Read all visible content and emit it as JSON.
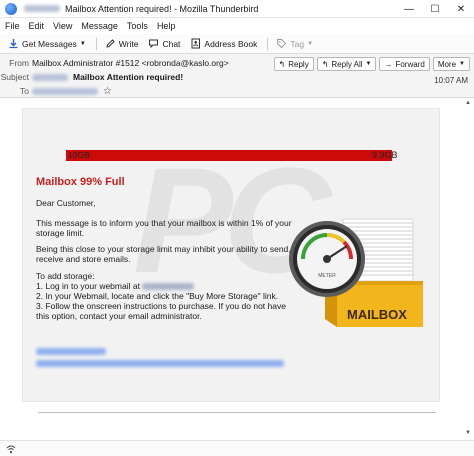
{
  "window": {
    "title": "Mailbox Attention required! - Mozilla Thunderbird",
    "controls": {
      "minimize": "—",
      "maximize": "☐",
      "close": "✕"
    }
  },
  "menu": [
    "File",
    "Edit",
    "View",
    "Message",
    "Tools",
    "Help"
  ],
  "toolbar": {
    "get_messages": "Get Messages",
    "write": "Write",
    "chat": "Chat",
    "address_book": "Address Book",
    "tag": "Tag"
  },
  "header": {
    "from_label": "From",
    "from_value": "Mailbox Administrator #1512 <robronda@kaslo.org>",
    "subject_label": "Subject",
    "subject_value": "Mailbox Attention required!",
    "to_label": "To",
    "time": "10:07 AM",
    "actions": {
      "reply": "Reply",
      "reply_all": "Reply All",
      "forward": "Forward",
      "more": "More"
    }
  },
  "email": {
    "storage": {
      "used_label": "10GB",
      "total_label": "9.9GB",
      "fill_fraction": 1.0,
      "bar_color": "#cc0a0a"
    },
    "heading": "Mailbox 99% Full",
    "greeting": "Dear Customer,",
    "para1": "This message is to inform you that your mailbox is within 1% of your storage limit.",
    "para2": "Being this close to your storage limit may inhibit your ability to send, receive and store emails.",
    "add_storage": "To add storage:",
    "step1": "1. Log in to your webmail at",
    "step2": "2. In your Webmail, locate and click the \"Buy More Storage\" link.",
    "step3": "3. Follow the onscreen instructions to purchase. If you do not have this option, contact your email administrator.",
    "gauge_label": "METER",
    "mailbox_label": "MAILBOX"
  },
  "colors": {
    "heading_red": "#c81e1e",
    "mailbox_gold": "#f2b51c"
  }
}
